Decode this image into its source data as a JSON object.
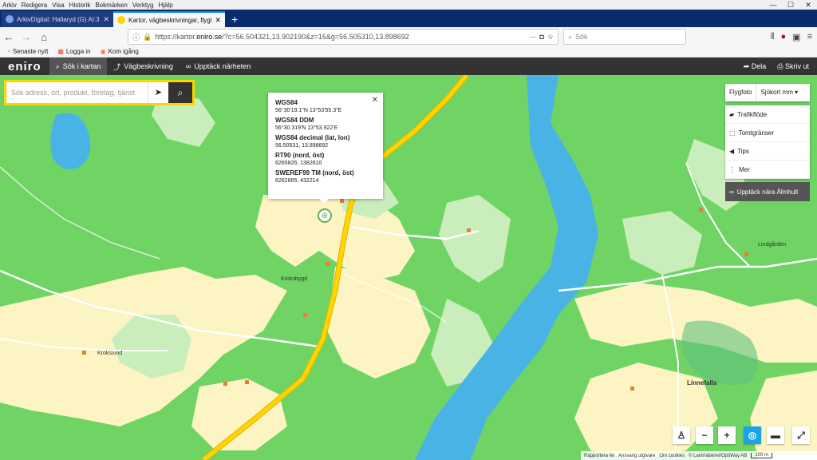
{
  "menubar": {
    "items": [
      "Arkiv",
      "Redigera",
      "Visa",
      "Historik",
      "Bokmärken",
      "Verktyg",
      "Hjälp"
    ]
  },
  "tabs": [
    {
      "title": "ArkivDigital: Hallaryd (G) AI:3 ...",
      "active": false
    },
    {
      "title": "Kartor, vägbeskrivningar, flygfo...",
      "active": true
    }
  ],
  "navbar": {
    "url_prefix": "https://kartor.",
    "url_domain": "eniro.se",
    "url_rest": "/?c=56.504321,13.902190&z=16&g=56.505310,13.898692",
    "search_placeholder": "Sök"
  },
  "bookmarks": [
    "Senaste nytt",
    "Logga in",
    "Kom igång"
  ],
  "eniro": {
    "logo": "eniro",
    "tabs": [
      "Sök i kartan",
      "Vägbeskrivning",
      "Upptäck närheten"
    ],
    "share": "Dela",
    "print": "Skriv ut"
  },
  "search": {
    "placeholder": "Sök adress, ort, produkt, företag, tjänst"
  },
  "popup": {
    "entries": [
      {
        "heading": "WGS84",
        "value": "56°30'19.1\"N 13°53'55.3\"E"
      },
      {
        "heading": "WGS84 DDM",
        "value": "56°30.319'N 13°53.922'E"
      },
      {
        "heading": "WGS84 decimal (lat, lon)",
        "value": "56.50531, 13.898692"
      },
      {
        "heading": "RT90 (nord, öst)",
        "value": "6265826, 1382610"
      },
      {
        "heading": "SWEREF99 TM (nord, öst)",
        "value": "6262865, 432214"
      }
    ]
  },
  "layers": {
    "flygfoto": "Flygfoto",
    "sjokort": "Sjökort mm",
    "items": [
      "Trafikflöde",
      "Tomtgränser",
      "Tips",
      "Mer"
    ],
    "discover": "Upptäck nära Älmhult"
  },
  "map_labels": [
    "Kroksbygd",
    "Kroksiund",
    "Lindgården",
    "Linnefalla"
  ],
  "footer": {
    "report": "Rapportera fel",
    "publisher": "Ansvarig utgivare",
    "cookies": "Om cookies",
    "copyright": "© Lantmäteriet/OptiWay AB",
    "scale": "100 m"
  },
  "colors": {
    "forest": "#6fd464",
    "field": "#fdf4c3",
    "meadow": "#c9eebb",
    "water": "#49b3e6",
    "road_main": "#ffd400",
    "accent": "#ffd400"
  }
}
